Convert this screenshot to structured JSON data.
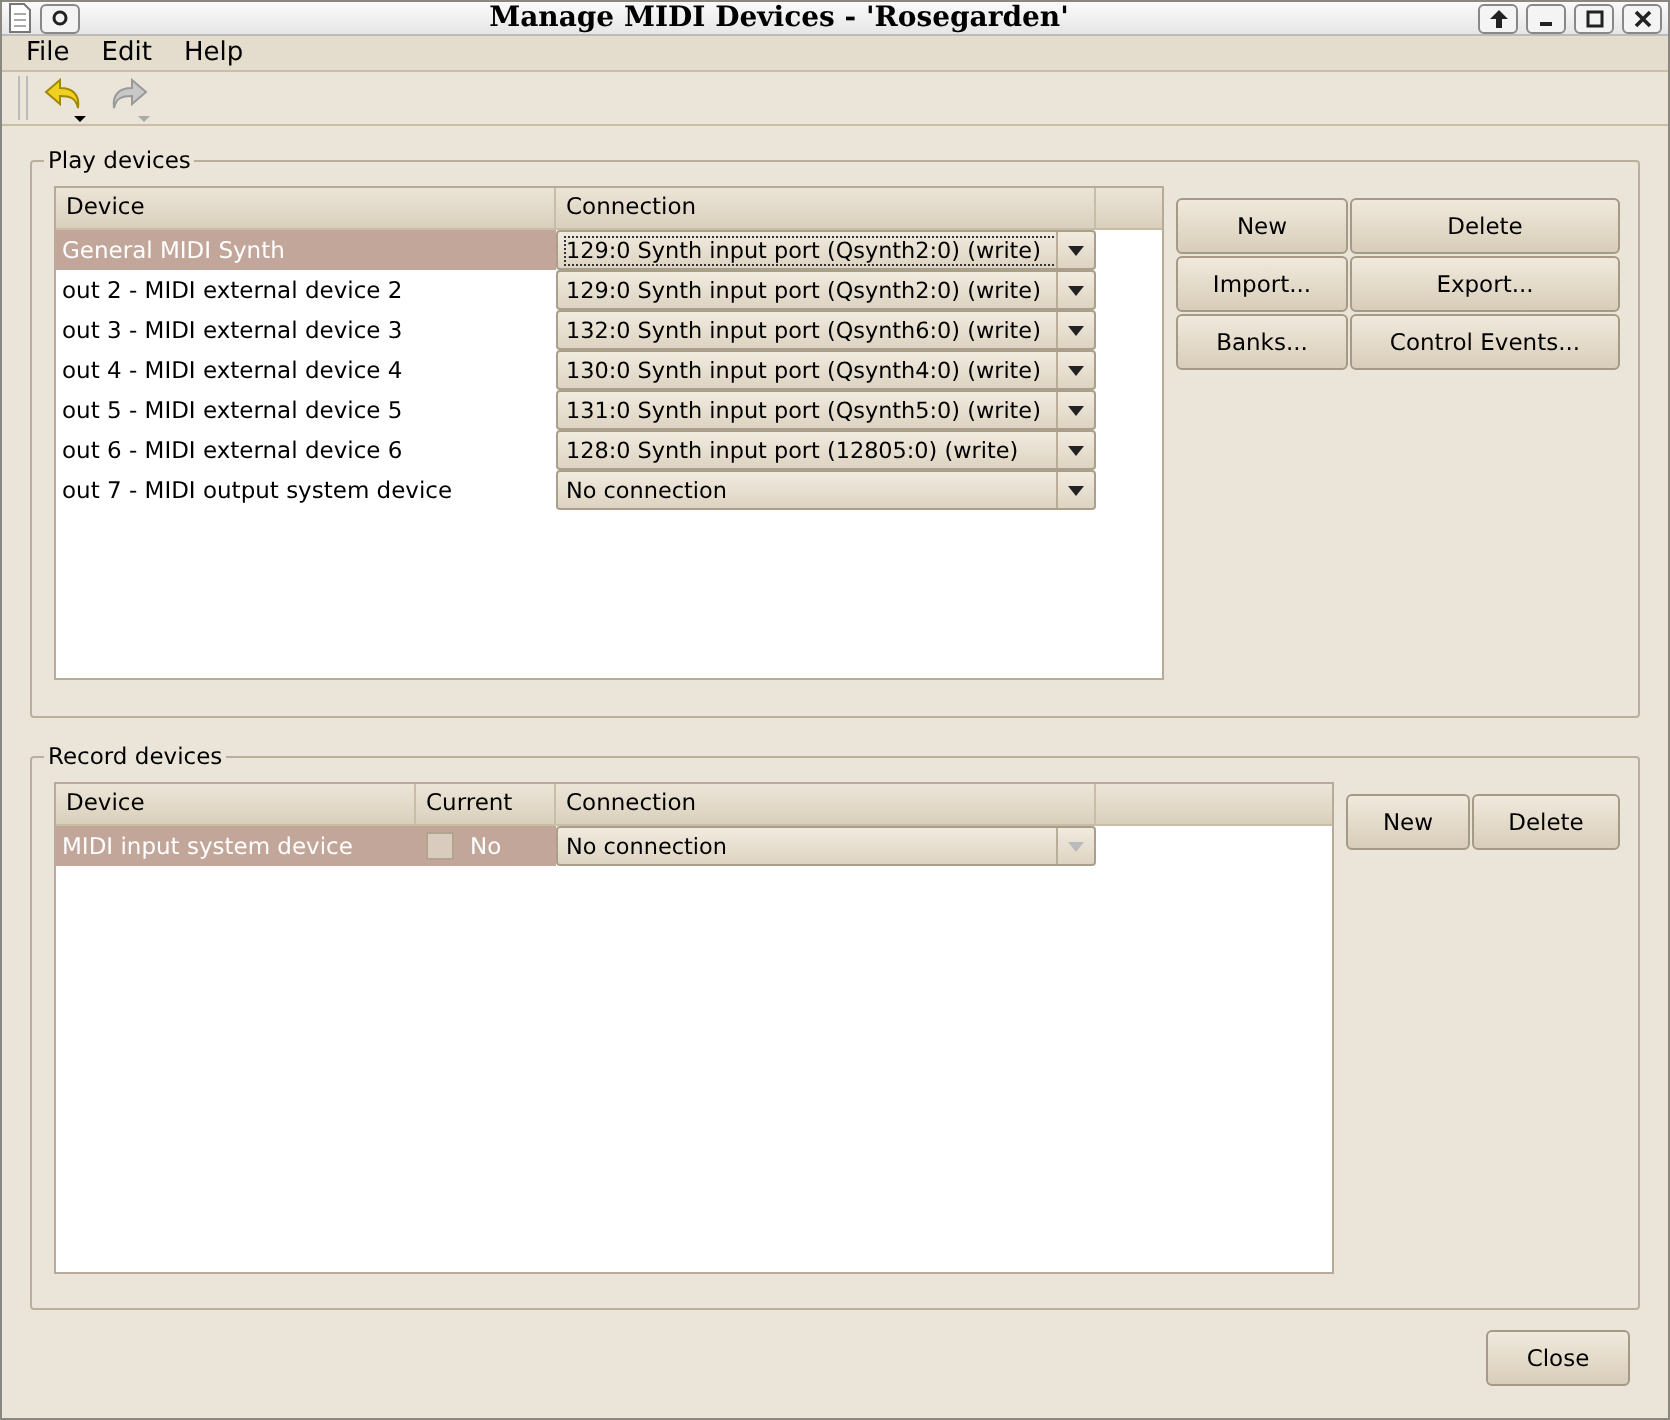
{
  "window": {
    "title": "Manage MIDI Devices - 'Rosegarden'"
  },
  "menu": [
    "File",
    "Edit",
    "Help"
  ],
  "play_devices": {
    "title": "Play devices",
    "columns": [
      "Device",
      "Connection"
    ],
    "rows": [
      {
        "device": "General MIDI Synth",
        "connection": "129:0 Synth input port (Qsynth2:0) (write)",
        "selected": true
      },
      {
        "device": "out 2 - MIDI external device 2",
        "connection": "129:0 Synth input port (Qsynth2:0) (write)",
        "selected": false
      },
      {
        "device": "out 3 - MIDI external device 3",
        "connection": "132:0 Synth input port (Qsynth6:0) (write)",
        "selected": false
      },
      {
        "device": "out 4 - MIDI external device 4",
        "connection": "130:0 Synth input port (Qsynth4:0) (write)",
        "selected": false
      },
      {
        "device": "out 5 - MIDI external device 5",
        "connection": "131:0 Synth input port (Qsynth5:0) (write)",
        "selected": false
      },
      {
        "device": "out 6 - MIDI external device 6",
        "connection": "128:0 Synth input port (12805:0) (write)",
        "selected": false
      },
      {
        "device": "out 7 - MIDI output system device",
        "connection": "No connection",
        "selected": false
      }
    ],
    "buttons": [
      "New",
      "Delete",
      "Import...",
      "Export...",
      "Banks...",
      "Control Events..."
    ]
  },
  "record_devices": {
    "title": "Record devices",
    "columns": [
      "Device",
      "Current",
      "Connection"
    ],
    "rows": [
      {
        "device": "MIDI input system device",
        "current": "No",
        "checked": false,
        "connection": "No connection",
        "selected": true
      }
    ],
    "buttons": [
      "New",
      "Delete"
    ]
  },
  "close_button": "Close"
}
